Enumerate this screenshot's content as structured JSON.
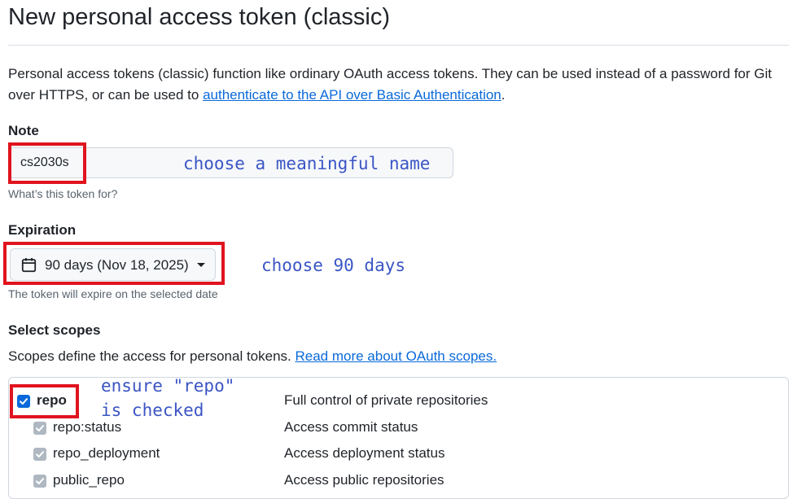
{
  "page": {
    "title": "New personal access token (classic)"
  },
  "intro": {
    "text_before": "Personal access tokens (classic) function like ordinary OAuth access tokens. They can be used instead of a password for Git over HTTPS, or can be used to ",
    "link_text": "authenticate to the API over Basic Authentication",
    "text_after": "."
  },
  "note": {
    "label": "Note",
    "value": "cs2030s",
    "hint": "What’s this token for?",
    "annotation": "choose a meaningful name"
  },
  "expiration": {
    "label": "Expiration",
    "selected": "90 days (Nov 18, 2025)",
    "hint": "The token will expire on the selected date",
    "annotation": "choose 90 days",
    "icon": "calendar-icon"
  },
  "scopes": {
    "label": "Select scopes",
    "description": "Scopes define the access for personal tokens. ",
    "link_text": "Read more about OAuth scopes.",
    "annotation": "ensure \"repo\"\nis checked",
    "items": [
      {
        "name": "repo",
        "description": "Full control of private repositories",
        "checked": true,
        "disabled": false
      },
      {
        "name": "repo:status",
        "description": "Access commit status",
        "checked": true,
        "disabled": true
      },
      {
        "name": "repo_deployment",
        "description": "Access deployment status",
        "checked": true,
        "disabled": true
      },
      {
        "name": "public_repo",
        "description": "Access public repositories",
        "checked": true,
        "disabled": true
      }
    ]
  },
  "colors": {
    "annotation_box": "#e0141e",
    "annotation_text": "#3b55c4",
    "link": "#0969da",
    "checkbox_checked": "#0969da",
    "checkbox_disabled": "#afb8c1"
  }
}
